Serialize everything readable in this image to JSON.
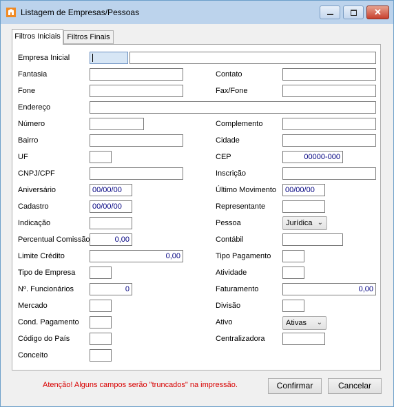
{
  "window": {
    "title": "Listagem de Empresas/Pessoas"
  },
  "tabs": [
    {
      "label": "Filtros Iniciais",
      "active": true
    },
    {
      "label": "Filtros Finais",
      "active": false
    }
  ],
  "labels": {
    "empresa_inicial": "Empresa Inicial",
    "fantasia": "Fantasia",
    "contato": "Contato",
    "fone": "Fone",
    "fax_fone": "Fax/Fone",
    "endereco": "Endereço",
    "numero": "Número",
    "complemento": "Complemento",
    "bairro": "Bairro",
    "cidade": "Cidade",
    "uf": "UF",
    "cep": "CEP",
    "cnpj_cpf": "CNPJ/CPF",
    "inscricao": "Inscrição",
    "aniversario": "Aniversário",
    "ultimo_movimento": "Último Movimento",
    "cadastro": "Cadastro",
    "representante": "Representante",
    "indicacao": "Indicação",
    "pessoa": "Pessoa",
    "percentual_comissao": "Percentual Comissão",
    "contabil": "Contábil",
    "limite_credito": "Limite Crédito",
    "tipo_pagamento": "Tipo Pagamento",
    "tipo_empresa": "Tipo de Empresa",
    "atividade": "Atividade",
    "n_funcionarios": "Nº. Funcionários",
    "faturamento": "Faturamento",
    "mercado": "Mercado",
    "divisao": "Divisão",
    "cond_pagamento": "Cond. Pagamento",
    "ativo": "Ativo",
    "codigo_pais": "Código do País",
    "centralizadora": "Centralizadora",
    "conceito": "Conceito"
  },
  "values": {
    "cep": "00000-000",
    "aniversario": "00/00/00",
    "ultimo_movimento": "00/00/00",
    "cadastro": "00/00/00",
    "percentual_comissao": "0,00",
    "limite_credito": "0,00",
    "n_funcionarios": "0",
    "faturamento": "0,00",
    "pessoa": "Jurídica",
    "ativo": "Ativas"
  },
  "footer": {
    "warning": "Atenção! Alguns campos serão \"truncados\" na impressão.",
    "confirm_label": "Confirmar",
    "cancel_label": "Cancelar"
  },
  "colors": {
    "warning": "#d80000",
    "field_value": "#000080",
    "titlebar": "#bcd3ec"
  }
}
